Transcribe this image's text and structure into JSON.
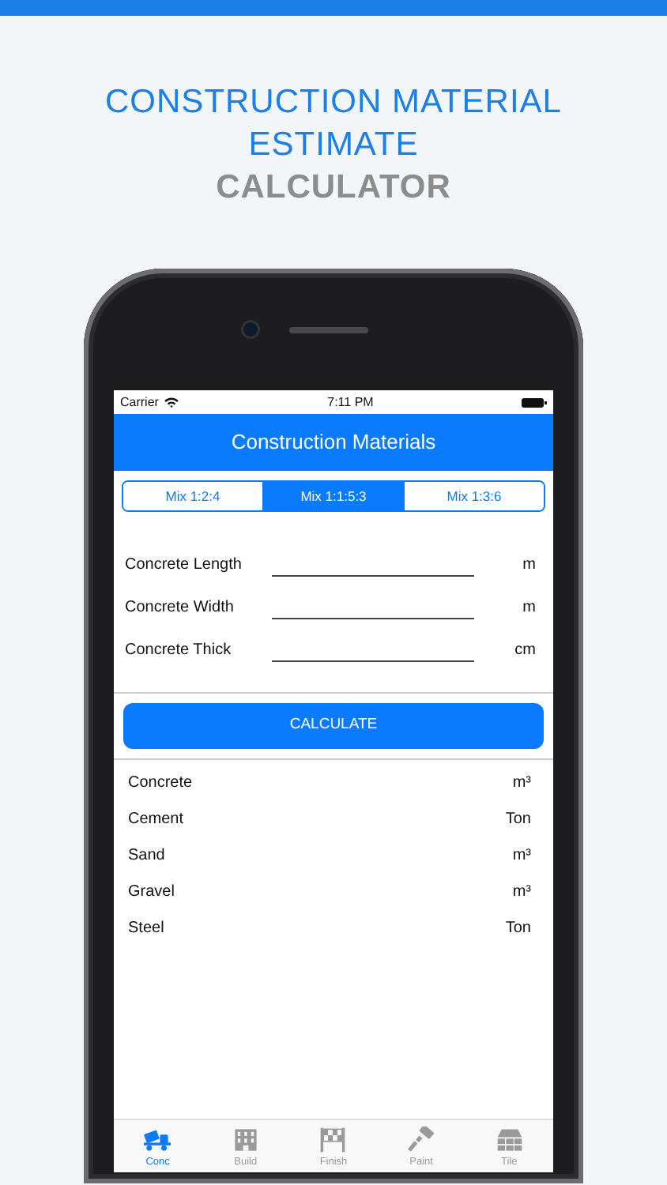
{
  "header": {
    "title": "CONSTRUCTION MATERIAL ESTIMATE",
    "subtitle": "CALCULATOR"
  },
  "status_bar": {
    "carrier": "Carrier",
    "time": "7:11 PM"
  },
  "nav_bar": {
    "title": "Construction Materials"
  },
  "mix_tabs": [
    {
      "label": "Mix 1:2:4",
      "selected": false
    },
    {
      "label": "Mix 1:1:5:3",
      "selected": true
    },
    {
      "label": "Mix 1:3:6",
      "selected": false
    }
  ],
  "inputs": [
    {
      "label": "Concrete Length",
      "unit": "m"
    },
    {
      "label": "Concrete Width",
      "unit": "m"
    },
    {
      "label": "Concrete Thick",
      "unit": "cm"
    }
  ],
  "calculate_button": "CALCULATE",
  "results": [
    {
      "name": "Concrete",
      "unit": "m³"
    },
    {
      "name": "Cement",
      "unit": "Ton"
    },
    {
      "name": "Sand",
      "unit": "m³"
    },
    {
      "name": "Gravel",
      "unit": "m³"
    },
    {
      "name": "Steel",
      "unit": "Ton"
    }
  ],
  "tab_bar": [
    {
      "label": "Conc",
      "selected": true
    },
    {
      "label": "Build",
      "selected": false
    },
    {
      "label": "Finish",
      "selected": false
    },
    {
      "label": "Paint",
      "selected": false
    },
    {
      "label": "Tile",
      "selected": false
    }
  ]
}
